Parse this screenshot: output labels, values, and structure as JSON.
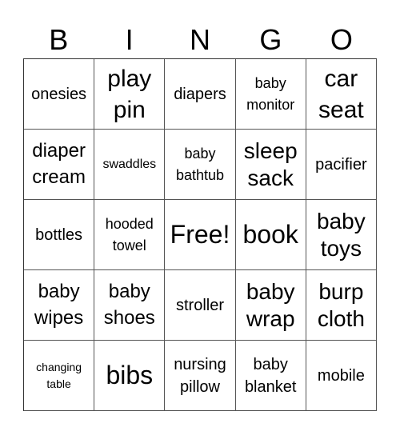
{
  "header": [
    "B",
    "I",
    "N",
    "G",
    "O"
  ],
  "cells": [
    [
      "onesies",
      "play pin",
      "diapers",
      "baby monitor",
      "car seat"
    ],
    [
      "diaper cream",
      "swaddles",
      "baby bathtub",
      "sleep sack",
      "pacifier"
    ],
    [
      "bottles",
      "hooded towel",
      "Free!",
      "book",
      "baby toys"
    ],
    [
      "baby wipes",
      "baby shoes",
      "stroller",
      "baby wrap",
      "burp cloth"
    ],
    [
      "changing table",
      "bibs",
      "nursing pillow",
      "baby blanket",
      "mobile"
    ]
  ]
}
